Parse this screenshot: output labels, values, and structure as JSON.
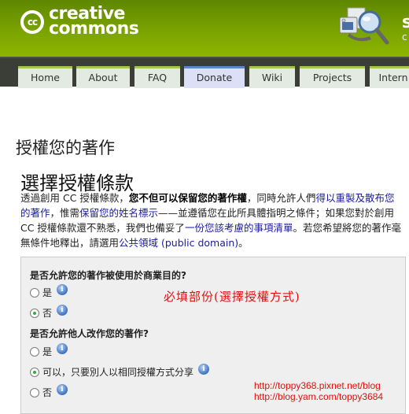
{
  "header": {
    "logo_mark": "cc",
    "logo_line1": "creative",
    "logo_line2": "commons",
    "search_letter": "s",
    "search_sub": "c"
  },
  "nav": {
    "tabs": [
      {
        "label": "Home",
        "active": false
      },
      {
        "label": "About",
        "active": false
      },
      {
        "label": "FAQ",
        "active": false
      },
      {
        "label": "Donate",
        "active": true
      },
      {
        "label": "Wiki",
        "active": false
      },
      {
        "label": "Projects",
        "active": false
      },
      {
        "label": "Intern",
        "active": false
      }
    ]
  },
  "page": {
    "title": "授權您的著作",
    "section_title": "選擇授權條款",
    "intro": {
      "t1": "透過創用 CC 授權條款，",
      "b1": "您不但可以保留您的著作權",
      "t2": "，同時允許人們",
      "l1": "得以重製及散布您的著作",
      "t3": "，惟需",
      "l2": "保留您的姓名標示",
      "t4": "——並遵循您在此所具體指明之條件；如果您對於創用 CC 授權條款還不熟悉，我們也備妥了",
      "l3": "一份您該考慮的事項清單",
      "t5": "。若您希望將您的著作毫無條件地釋出，請選用",
      "l4": "公共領域 (public domain)",
      "t6": "。"
    }
  },
  "form": {
    "q1": {
      "label": "是否允許您的著作被使用於商業目的?",
      "options": [
        {
          "label": "是",
          "checked": false
        },
        {
          "label": "否",
          "checked": true
        }
      ]
    },
    "q2": {
      "label": "是否允許他人改作您的著作?",
      "options": [
        {
          "label": "是",
          "checked": false
        },
        {
          "label": "可以，只要別人以相同授權方式分享",
          "checked": true
        },
        {
          "label": "否",
          "checked": false
        }
      ]
    },
    "info_glyph": "i"
  },
  "annotation": {
    "note": "必填部份(選擇授權方式)",
    "watermark1": "http://toppy368.pixnet.net/blog",
    "watermark2": "http://blog.yam.com/toppy3684"
  }
}
